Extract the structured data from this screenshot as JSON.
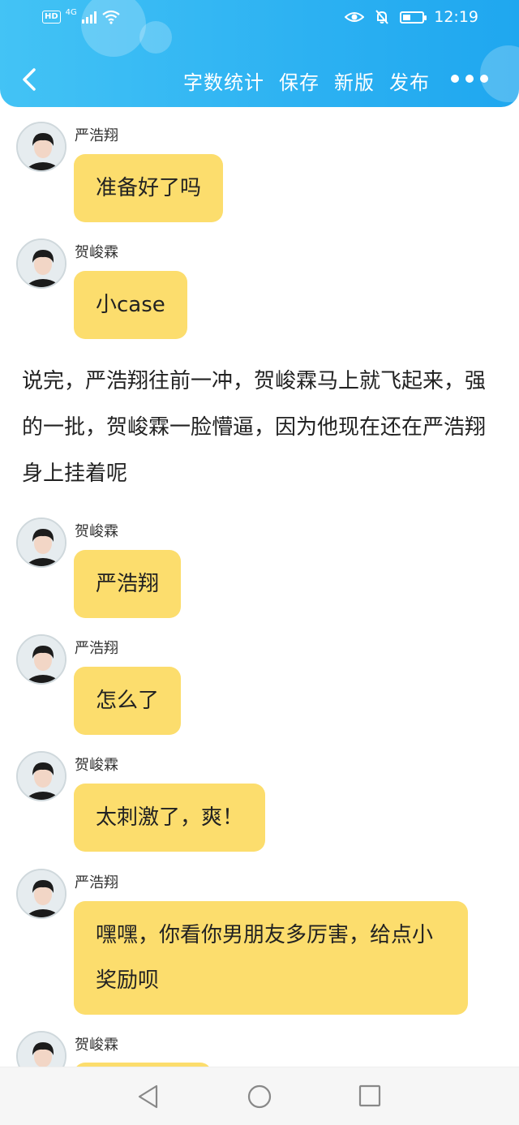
{
  "status_bar": {
    "hd": "HD",
    "network": "4G",
    "time": "12:19"
  },
  "nav": {
    "actions": [
      "字数统计",
      "保存",
      "新版",
      "发布"
    ]
  },
  "messages": [
    {
      "name": "严浩翔",
      "text": "准备好了吗"
    },
    {
      "name": "贺峻霖",
      "text": "小case"
    },
    {
      "name": "贺峻霖",
      "text": "严浩翔"
    },
    {
      "name": "严浩翔",
      "text": "怎么了"
    },
    {
      "name": "贺峻霖",
      "text": "太刺激了，爽！"
    },
    {
      "name": "严浩翔",
      "text": "嘿嘿，你看你男朋友多厉害，给点小奖励呗"
    },
    {
      "name": "贺峻霖",
      "text": ""
    }
  ],
  "narration": "说完，严浩翔往前一冲，贺峻霖马上就飞起来，强的一批，贺峻霖一脸懵逼，因为他现在还在严浩翔身上挂着呢",
  "colors": {
    "header": "#2cb1f2",
    "bubble": "#fcdd6d"
  }
}
